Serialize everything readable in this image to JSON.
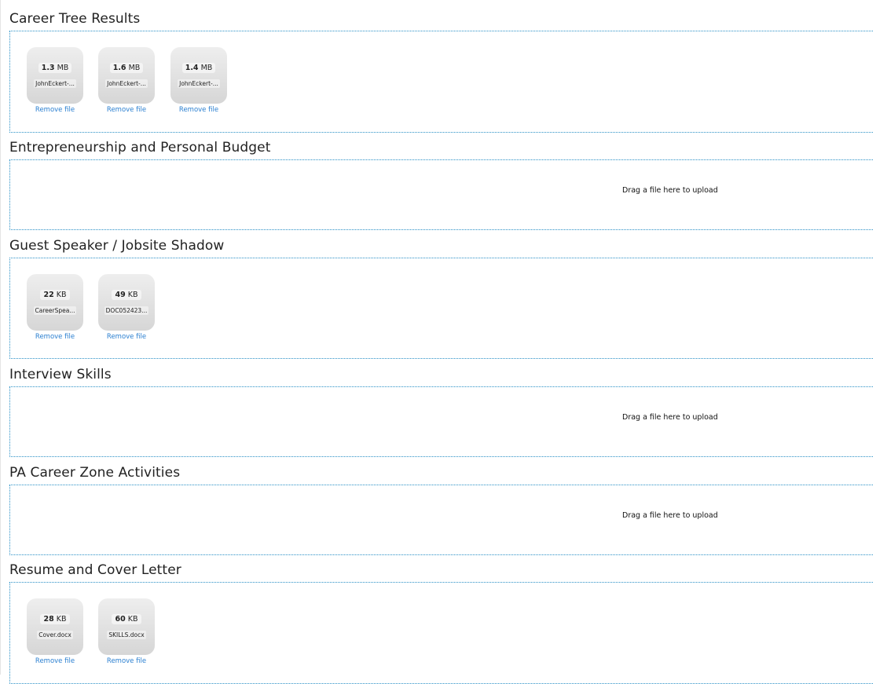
{
  "sections": [
    {
      "title": "Career Tree Results",
      "files": [
        {
          "size": "1.3",
          "unit": "MB",
          "name": "JohnEckert-..."
        },
        {
          "size": "1.6",
          "unit": "MB",
          "name": "JohnEckert-..."
        },
        {
          "size": "1.4",
          "unit": "MB",
          "name": "JohnEckert-..."
        }
      ]
    },
    {
      "title": "Entrepreneurship and Personal Budget",
      "message": "Drag a file here to upload"
    },
    {
      "title": "Guest Speaker / Jobsite Shadow",
      "files": [
        {
          "size": "22",
          "unit": "KB",
          "name": "CareerSpea..."
        },
        {
          "size": "49",
          "unit": "KB",
          "name": "DOC052423..."
        }
      ]
    },
    {
      "title": "Interview Skills",
      "message": "Drag a file here to upload"
    },
    {
      "title": "PA Career Zone Activities",
      "message": "Drag a file here to upload"
    },
    {
      "title": "Resume and Cover Letter",
      "files": [
        {
          "size": "28",
          "unit": "KB",
          "name": "Cover.docx"
        },
        {
          "size": "60",
          "unit": "KB",
          "name": "SKILLS.docx"
        }
      ]
    }
  ],
  "remove_label": "Remove file"
}
